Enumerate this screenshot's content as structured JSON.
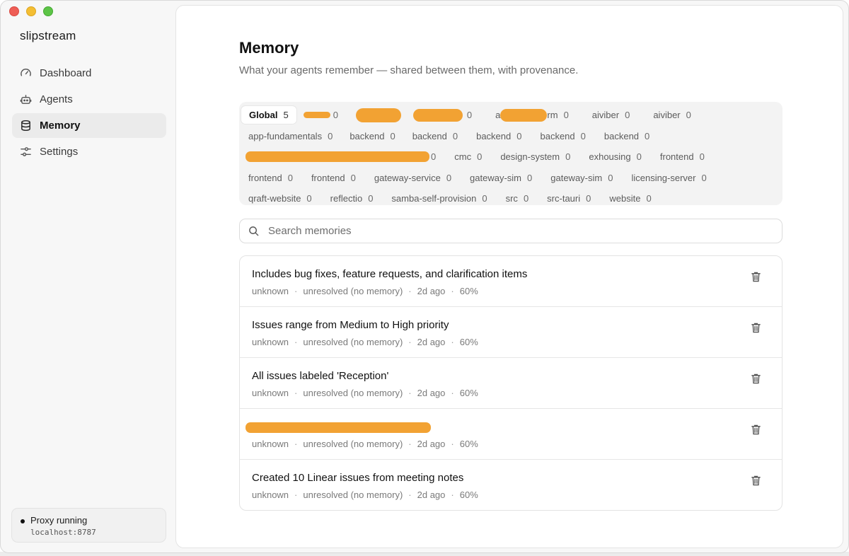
{
  "app": {
    "brand": "slipstream"
  },
  "sidebar": {
    "items": [
      {
        "label": "Dashboard",
        "icon": "gauge-icon"
      },
      {
        "label": "Agents",
        "icon": "robot-icon"
      },
      {
        "label": "Memory",
        "icon": "database-icon",
        "active": true
      },
      {
        "label": "Settings",
        "icon": "sliders-icon"
      }
    ],
    "proxy": {
      "label": "Proxy running",
      "host": "localhost:8787"
    }
  },
  "page": {
    "title": "Memory",
    "subtitle": "What your agents remember — shared between them, with provenance."
  },
  "scopes": {
    "rows": [
      [
        {
          "label": "Global",
          "count": "5",
          "active": true
        },
        {
          "label": "",
          "count": "0",
          "redacted": true
        },
        {
          "label": "",
          "count": "",
          "redacted": true
        },
        {
          "label": "",
          "count": "0",
          "redacted": true
        },
        {
          "label": "a",
          "suffix": "rm",
          "count": "0",
          "redacted": true
        },
        {
          "label": "aiviber",
          "count": "0"
        },
        {
          "label": "aiviber",
          "count": "0"
        }
      ],
      [
        {
          "label": "app-fundamentals",
          "count": "0"
        },
        {
          "label": "backend",
          "count": "0"
        },
        {
          "label": "backend",
          "count": "0"
        },
        {
          "label": "backend",
          "count": "0"
        },
        {
          "label": "backend",
          "count": "0"
        },
        {
          "label": "backend",
          "count": "0"
        }
      ],
      [
        {
          "label": "",
          "count": "0",
          "redacted": true
        },
        {
          "label": "cmc",
          "count": "0"
        },
        {
          "label": "design-system",
          "count": "0"
        },
        {
          "label": "exhousing",
          "count": "0"
        },
        {
          "label": "frontend",
          "count": "0"
        }
      ],
      [
        {
          "label": "frontend",
          "count": "0"
        },
        {
          "label": "frontend",
          "count": "0"
        },
        {
          "label": "gateway-service",
          "count": "0"
        },
        {
          "label": "gateway-sim",
          "count": "0"
        },
        {
          "label": "gateway-sim",
          "count": "0"
        },
        {
          "label": "licensing-server",
          "count": "0"
        }
      ],
      [
        {
          "label": "qraft-website",
          "count": "0"
        },
        {
          "label": "reflectio",
          "count": "0"
        },
        {
          "label": "samba-self-provision",
          "count": "0"
        },
        {
          "label": "src",
          "count": "0"
        },
        {
          "label": "src-tauri",
          "count": "0"
        },
        {
          "label": "website",
          "count": "0"
        }
      ]
    ]
  },
  "search": {
    "placeholder": "Search memories",
    "value": ""
  },
  "memories": [
    {
      "title": "Includes bug fixes, feature requests, and clarification items",
      "source": "unknown",
      "status": "unresolved (no memory)",
      "age": "2d ago",
      "confidence": "60%"
    },
    {
      "title": "Issues range from Medium to High priority",
      "source": "unknown",
      "status": "unresolved (no memory)",
      "age": "2d ago",
      "confidence": "60%"
    },
    {
      "title": "All issues labeled 'Reception'",
      "source": "unknown",
      "status": "unresolved (no memory)",
      "age": "2d ago",
      "confidence": "60%"
    },
    {
      "title": "",
      "redacted": true,
      "source": "unknown",
      "status": "unresolved (no memory)",
      "age": "2d ago",
      "confidence": "60%"
    },
    {
      "title": "Created 10 Linear issues from meeting notes",
      "source": "unknown",
      "status": "unresolved (no memory)",
      "age": "2d ago",
      "confidence": "60%"
    }
  ],
  "colors": {
    "accent_redaction": "#f2a233",
    "traffic_red": "#ee5d55",
    "traffic_yellow": "#f4be33",
    "traffic_green": "#5dc447"
  }
}
